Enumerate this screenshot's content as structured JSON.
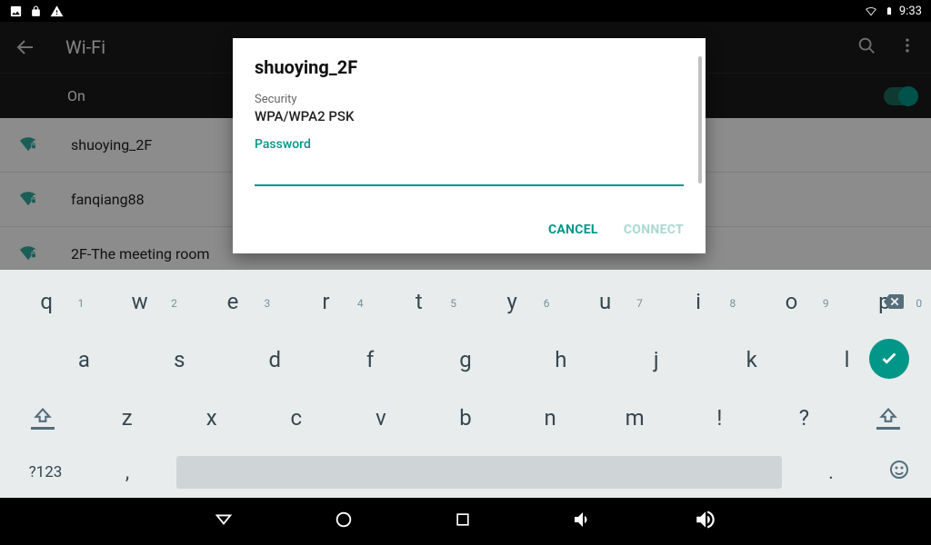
{
  "status": {
    "time": "9:33"
  },
  "appbar": {
    "title": "Wi-Fi"
  },
  "toggle": {
    "label": "On"
  },
  "networks": [
    {
      "ssid": "shuoying_2F"
    },
    {
      "ssid": "fanqiang88"
    },
    {
      "ssid": "2F-The meeting room"
    }
  ],
  "dialog": {
    "title": "shuoying_2F",
    "security_label": "Security",
    "security_value": "WPA/WPA2 PSK",
    "password_label": "Password",
    "password_value": "",
    "cancel": "CANCEL",
    "connect": "CONNECT"
  },
  "keyboard": {
    "row1": [
      "q",
      "w",
      "e",
      "r",
      "t",
      "y",
      "u",
      "i",
      "o",
      "p"
    ],
    "row1_hints": [
      "1",
      "2",
      "3",
      "4",
      "5",
      "6",
      "7",
      "8",
      "9",
      "0"
    ],
    "row2": [
      "a",
      "s",
      "d",
      "f",
      "g",
      "h",
      "j",
      "k",
      "l"
    ],
    "row3": [
      "z",
      "x",
      "c",
      "v",
      "b",
      "n",
      "m",
      "!",
      "?"
    ],
    "sym": "?123",
    "comma": ",",
    "period": "."
  }
}
